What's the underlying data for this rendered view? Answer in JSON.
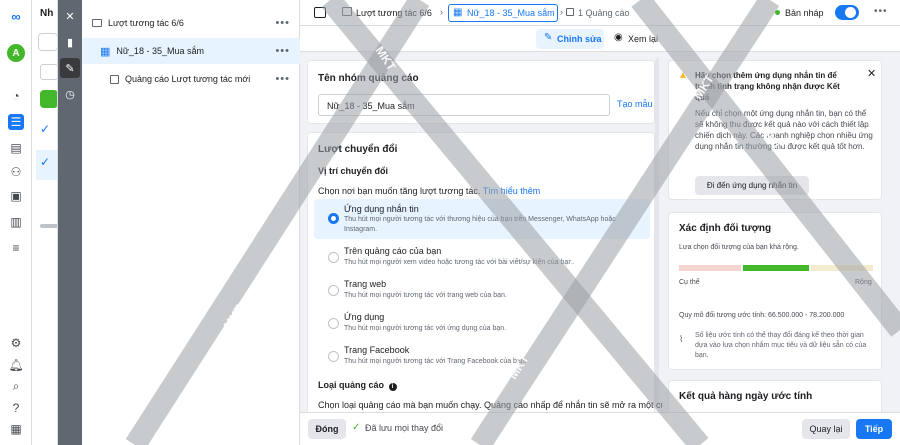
{
  "tree": {
    "campaign": "Lượt tương tác 6/6",
    "adset": "Nữ_18 - 35_Mua sắm",
    "ad": "Quảng cáo Lượt tương tác mới"
  },
  "hidden_panel": {
    "title_fragment": "Nh"
  },
  "breadcrumb": {
    "campaign": "Lượt tương tác 6/6",
    "adset": "Nữ_18 - 35_Mua sắm",
    "ad": "1 Quảng cáo"
  },
  "status": {
    "draft": "Bản nháp"
  },
  "mode_tabs": {
    "edit": "Chỉnh sửa",
    "review": "Xem lại"
  },
  "adset_name": {
    "heading": "Tên nhóm quảng cáo",
    "value": "Nữ_18 - 35_Mua sắm",
    "template_link": "Tạo mẫu"
  },
  "conversion": {
    "heading": "Lượt chuyển đổi",
    "location_label": "Vị trí chuyển đổi",
    "location_help": "Chọn nơi bạn muốn tăng lượt tương tác.",
    "learn_more": "Tìm hiểu thêm",
    "options": [
      {
        "title": "Ứng dụng nhắn tin",
        "desc": "Thu hút mọi người tương tác với thương hiệu của bạn trên Messenger, WhatsApp hoặc Instagram."
      },
      {
        "title": "Trên quảng cáo của bạn",
        "desc": "Thu hút mọi người xem video hoặc tương tác với bài viết/sự kiện của bạn."
      },
      {
        "title": "Trang web",
        "desc": "Thu hút mọi người tương tác với trang web của bạn."
      },
      {
        "title": "Ứng dụng",
        "desc": "Thu hút mọi người tương tác với ứng dụng của bạn."
      },
      {
        "title": "Trang Facebook",
        "desc": "Thu hút mọi người tương tác với Trang Facebook của bạn."
      }
    ],
    "selected_index": 0,
    "ad_type_label": "Loại quảng cáo",
    "ad_type_help": "Chọn loại quảng cáo mà bạn muốn chạy. Quảng cáo nhấp để nhắn tin sẽ mở ra một cuộc"
  },
  "warning": {
    "title": "Hãy chọn thêm ứng dụng nhắn tin để tránh tình trạng không nhận được Kết quả",
    "body": "Nếu chỉ chọn một ứng dụng nhắn tin, bạn có thể sẽ không thu được kết quả nào với cách thiết lập chiến dịch này. Các doanh nghiệp chọn nhiều ứng dụng nhắn tin thường thu được kết quả tốt hơn.",
    "button": "Đi đến ứng dụng nhắn tin"
  },
  "audience": {
    "heading": "Xác định đối tượng",
    "subtitle": "Lựa chọn đối tượng của bạn khá rộng.",
    "specific": "Cụ thể",
    "broad": "Rộng",
    "meter_level": 0.5,
    "size_label": "Quy mô đối tượng ước tính: 66.500.000 - 78.200.000",
    "note": "Số liệu ước tính có thể thay đổi đáng kể theo thời gian dựa vào lựa chọn nhắm mục tiêu và dữ liệu sẵn có của bạn."
  },
  "daily_results": {
    "heading": "Kết quả hàng ngày ước tính"
  },
  "footer": {
    "close": "Đóng",
    "saved": "Đã lưu mọi thay đổi",
    "back": "Quay lại",
    "next": "Tiếp"
  },
  "watermark": {
    "text": "MKT"
  },
  "colors": {
    "accent": "#1877f2",
    "success": "#42b72a",
    "warning": "#f7b928"
  }
}
